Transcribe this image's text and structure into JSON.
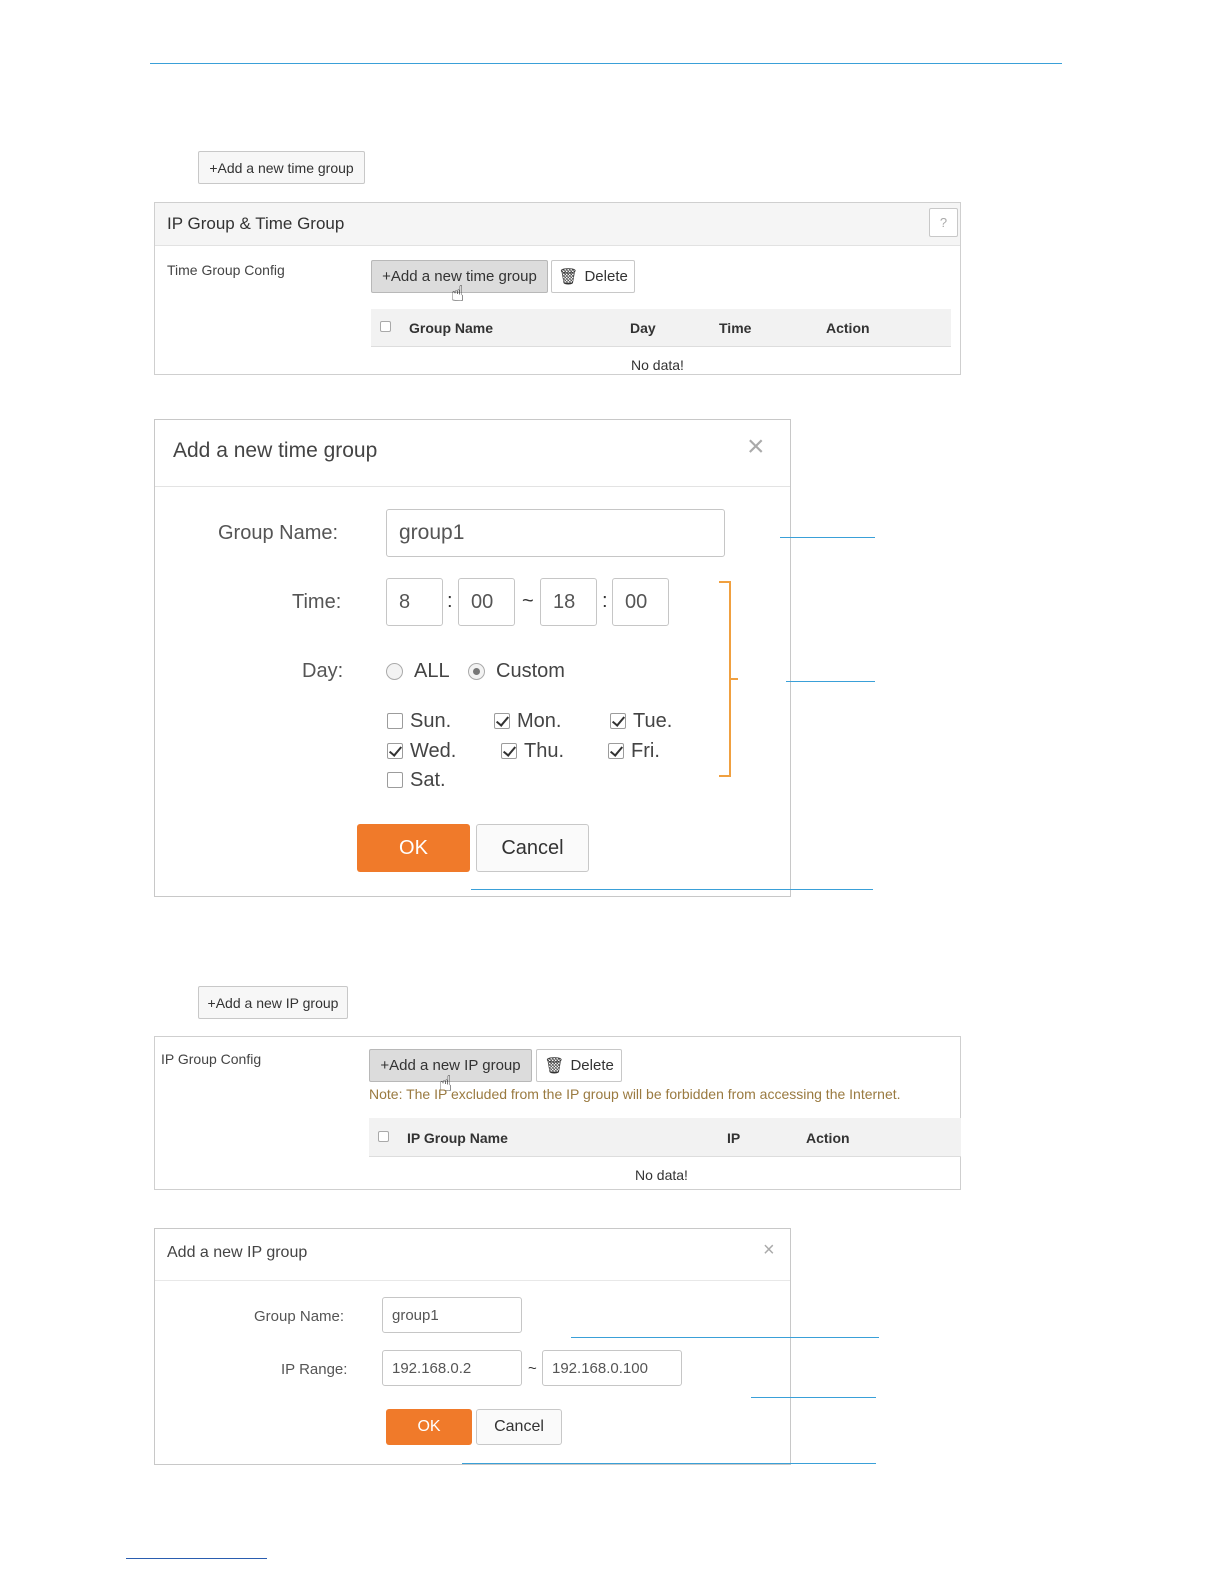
{
  "top_button": {
    "add_time_group": "+Add a new time group"
  },
  "time_panel": {
    "title": "IP Group & Time Group",
    "help_label": "?",
    "config_label": "Time Group Config",
    "add_button": "+Add a new time group",
    "delete_button": "Delete",
    "columns": [
      "Group Name",
      "Day",
      "Time",
      "Action"
    ],
    "empty_text": "No data!"
  },
  "time_dialog": {
    "title": "Add a new time group",
    "close": "×",
    "group_name_label": "Group Name:",
    "group_name_value": "group1",
    "time_label": "Time:",
    "start_hour": "8",
    "start_min": "00",
    "end_hour": "18",
    "end_min": "00",
    "colon": ":",
    "tilde": "~",
    "day_label": "Day:",
    "day_options": {
      "all": "ALL",
      "custom": "Custom",
      "selected": "Custom"
    },
    "days": [
      {
        "label": "Sun.",
        "checked": false
      },
      {
        "label": "Mon.",
        "checked": true
      },
      {
        "label": "Tue.",
        "checked": true
      },
      {
        "label": "Wed.",
        "checked": true
      },
      {
        "label": "Thu.",
        "checked": true
      },
      {
        "label": "Fri.",
        "checked": true
      },
      {
        "label": "Sat.",
        "checked": false
      }
    ],
    "ok": "OK",
    "cancel": "Cancel"
  },
  "ip_top_button": {
    "add_ip_group": "+Add a new IP group"
  },
  "ip_panel": {
    "config_label": "IP Group Config",
    "add_button": "+Add a new IP group",
    "delete_button": "Delete",
    "note": "Note: The IP excluded from the IP group will be forbidden from accessing the Internet.",
    "columns": [
      "IP Group Name",
      "IP",
      "Action"
    ],
    "empty_text": "No data!"
  },
  "ip_dialog": {
    "title": "Add a new IP group",
    "close": "×",
    "group_name_label": "Group Name:",
    "group_name_value": "group1",
    "ip_range_label": "IP Range:",
    "ip_start": "192.168.0.2",
    "ip_end": "192.168.0.100",
    "tilde": "~",
    "ok": "OK",
    "cancel": "Cancel"
  },
  "colors": {
    "accent_line": "#3aa0d8",
    "ok_button": "#f07a2a",
    "bracket": "#f0a040",
    "note_text": "#9a7a40"
  }
}
